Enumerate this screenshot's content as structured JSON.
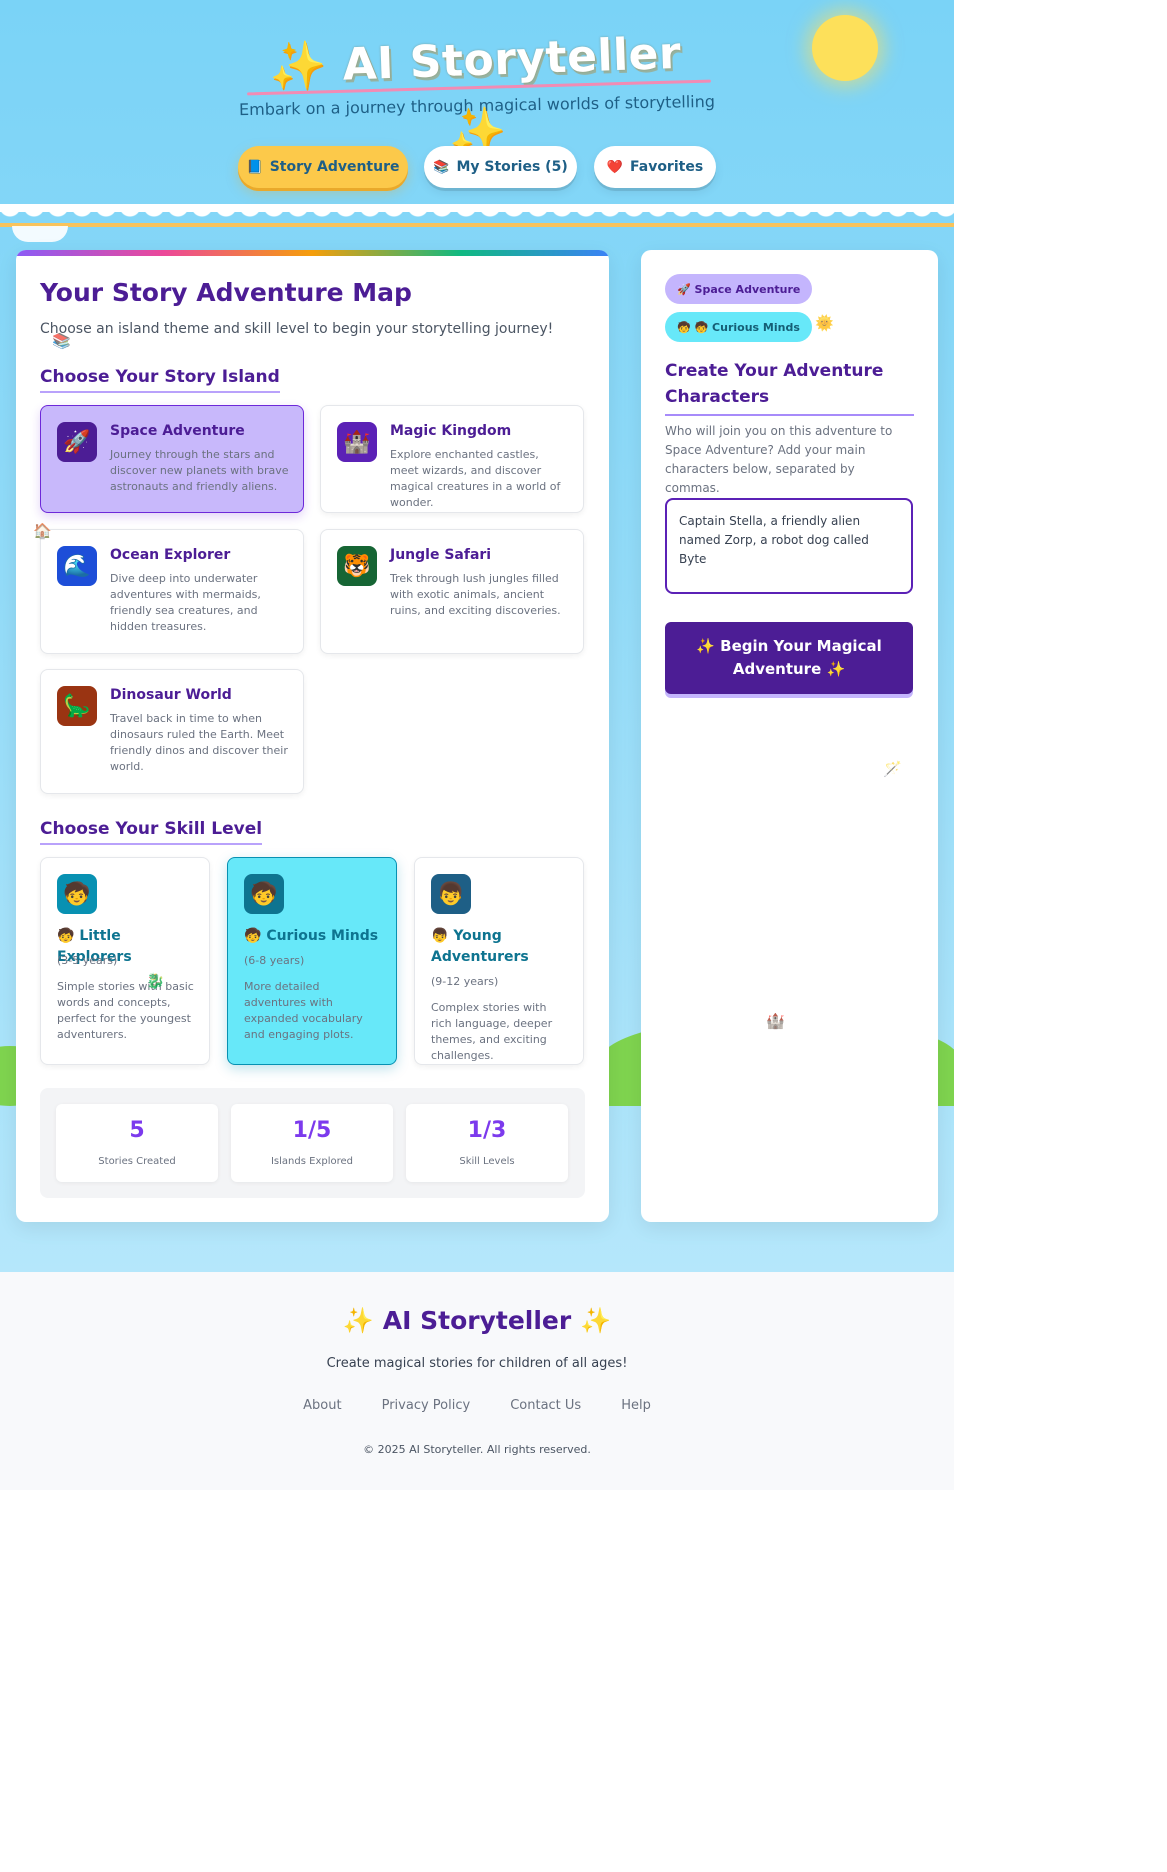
{
  "header": {
    "title": "AI Storyteller",
    "spark_left": "✨",
    "spark_right": "✨",
    "subtitle": "Embark on a journey through magical worlds of storytelling"
  },
  "nav": [
    {
      "icon": "📘",
      "label": "Story Adventure",
      "active": true
    },
    {
      "icon": "📚",
      "label": "My Stories (5)",
      "active": false
    },
    {
      "icon": "❤️",
      "label": "Favorites",
      "active": false
    }
  ],
  "main": {
    "heading": "Your Story Adventure Map",
    "intro": "Choose an island theme and skill level to begin your storytelling journey!",
    "islands_title": "Choose Your Story Island",
    "islands": [
      {
        "icon": "🚀",
        "color": "#4c1d95",
        "name": "Space Adventure",
        "desc": "Journey through the stars and discover new planets with brave astronauts and friendly aliens.",
        "selected": true
      },
      {
        "icon": "🏰",
        "color": "#5b21b6",
        "name": "Magic Kingdom",
        "desc": "Explore enchanted castles, meet wizards, and discover magical creatures in a world of wonder.",
        "selected": false
      },
      {
        "icon": "🌊",
        "color": "#1d4ed8",
        "name": "Ocean Explorer",
        "desc": "Dive deep into underwater adventures with mermaids, friendly sea creatures, and hidden treasures.",
        "selected": false
      },
      {
        "icon": "🐯",
        "color": "#166534",
        "name": "Jungle Safari",
        "desc": "Trek through lush jungles filled with exotic animals, ancient ruins, and exciting discoveries.",
        "selected": false
      },
      {
        "icon": "🦕",
        "color": "#9a3412",
        "name": "Dinosaur World",
        "desc": "Travel back in time to when dinosaurs ruled the Earth. Meet friendly dinos and discover their world.",
        "selected": false
      }
    ],
    "skills_title": "Choose Your Skill Level",
    "skills": [
      {
        "badge": "🧒",
        "color": "#0891b2",
        "emoji": "🧒",
        "name": "Little Explorers",
        "age": "(3-5 years)",
        "desc": "Simple stories with basic words and concepts, perfect for the youngest adventurers.",
        "selected": false
      },
      {
        "badge": "🧒",
        "color": "#0e7490",
        "emoji": "🧒",
        "name": "Curious Minds",
        "age": "(6-8 years)",
        "desc": "More detailed adventures with expanded vocabulary and engaging plots.",
        "selected": true
      },
      {
        "badge": "👦",
        "color": "#1e5f86",
        "emoji": "👦",
        "name": "Young Adventurers",
        "age": "(9-12 years)",
        "desc": "Complex stories with rich language, deeper themes, and exciting challenges.",
        "selected": false
      }
    ],
    "stats": [
      {
        "value": "5",
        "label": "Stories Created"
      },
      {
        "value": "1/5",
        "label": "Islands Explored"
      },
      {
        "value": "1/3",
        "label": "Skill Levels"
      }
    ]
  },
  "side": {
    "chip_theme": "🚀 Space Adventure",
    "chip_skill": "🧒 🧒 Curious Minds",
    "title": "Create Your Adventure Characters",
    "desc": "Who will join you on this adventure to Space Adventure? Add your main characters below, separated by commas.",
    "characters_value": "Captain Stella, a friendly alien named Zorp, a robot dog called Byte",
    "begin_label": "✨ Begin Your Magical Adventure ✨"
  },
  "footer": {
    "title": "AI Storyteller",
    "spark": "✨",
    "tagline": "Create magical stories for children of all ages!",
    "links": [
      "About",
      "Privacy Policy",
      "Contact Us",
      "Help"
    ],
    "copyright": "© 2025 AI Storyteller. All rights reserved."
  }
}
